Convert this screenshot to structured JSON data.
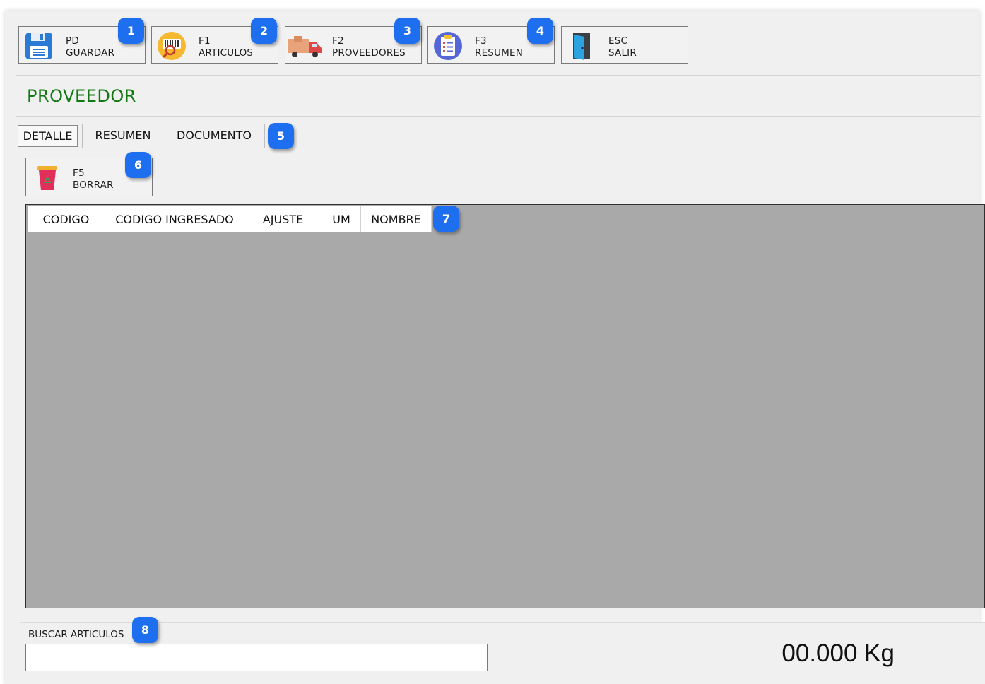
{
  "toolbar": {
    "save": {
      "key": "PD",
      "label": "GUARDAR",
      "badge": "1",
      "icon": "floppy-disk-icon"
    },
    "articles": {
      "key": "F1",
      "label": "ARTICULOS",
      "badge": "2",
      "icon": "barcode-search-icon"
    },
    "suppliers": {
      "key": "F2",
      "label": "PROVEEDORES",
      "badge": "3",
      "icon": "delivery-truck-icon"
    },
    "summary": {
      "key": "F3",
      "label": "RESUMEN",
      "badge": "4",
      "icon": "clipboard-icon"
    },
    "exit": {
      "key": "ESC",
      "label": "SALIR",
      "badge": "",
      "icon": "exit-door-icon"
    }
  },
  "section_title": "PROVEEDOR",
  "tabs": {
    "items": [
      {
        "label": "DETALLE",
        "active": true
      },
      {
        "label": "RESUMEN",
        "active": false
      },
      {
        "label": "DOCUMENTO",
        "active": false
      }
    ],
    "badge": "5"
  },
  "delete_button": {
    "key": "F5",
    "label": "BORRAR",
    "badge": "6",
    "icon": "trash-bin-icon"
  },
  "grid": {
    "columns": [
      "CODIGO",
      "CODIGO INGRESADO",
      "AJUSTE",
      "UM",
      "NOMBRE"
    ],
    "badge": "7",
    "rows": []
  },
  "search": {
    "label": "BUSCAR ARTICULOS",
    "value": "",
    "badge": "8"
  },
  "weight_display": "00.000 Kg",
  "colors": {
    "badge": "#1e6ff0",
    "title": "#137713",
    "grid_bg": "#a9a9a9"
  }
}
